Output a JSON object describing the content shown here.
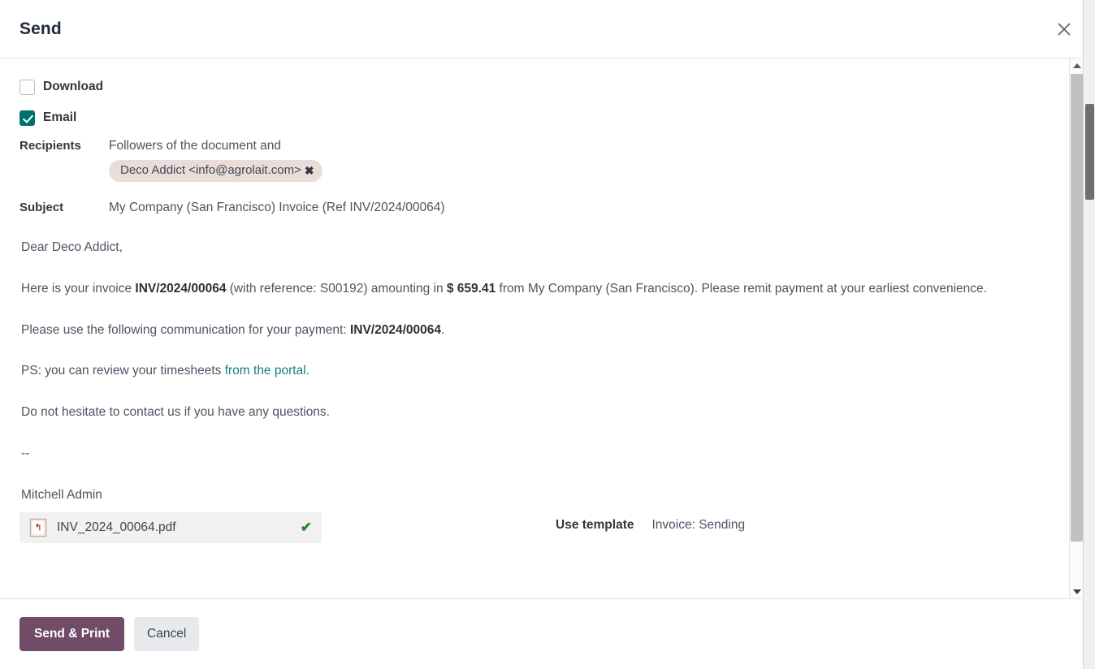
{
  "dialog": {
    "title": "Send",
    "close_icon": "close-icon"
  },
  "options": {
    "download": {
      "label": "Download",
      "checked": false
    },
    "email": {
      "label": "Email",
      "checked": true
    }
  },
  "recipients": {
    "label": "Recipients",
    "description": "Followers of the document and",
    "tags": [
      {
        "text": "Deco Addict <info@agrolait.com>",
        "remove_icon": "✖"
      }
    ]
  },
  "subject": {
    "label": "Subject",
    "value": "My Company (San Francisco) Invoice (Ref INV/2024/00064)"
  },
  "message": {
    "greeting": "Dear Deco Addict,",
    "para1_part1": "Here is your invoice ",
    "para1_invoice": "INV/2024/00064",
    "para1_part2": " (with reference: S00192) amounting in ",
    "para1_amount": "$ 659.41",
    "para1_part3": " from My Company (San Francisco). Please remit payment at your earliest convenience.",
    "para2_part1": "Please use the following communication for your payment: ",
    "para2_invoice": "INV/2024/00064",
    "para2_part2": ".",
    "para3_part1": "PS: you can review your timesheets ",
    "para3_link": "from the portal.",
    "para4": "Do not hesitate to contact us if you have any questions.",
    "signature_dashes": "--",
    "signature_name": "Mitchell Admin"
  },
  "attachment": {
    "filename": "INV_2024_00064.pdf",
    "icon": "pdf-file-icon",
    "status_icon": "✔"
  },
  "template": {
    "label": "Use template",
    "value": "Invoice: Sending"
  },
  "footer": {
    "primary_label": "Send & Print",
    "secondary_label": "Cancel"
  },
  "colors": {
    "primary": "#714b67",
    "checkbox_checked": "#00706b",
    "link": "#1a7f7a",
    "tag_bg": "#e9dcd9",
    "attachment_check": "#1e8a2f"
  }
}
